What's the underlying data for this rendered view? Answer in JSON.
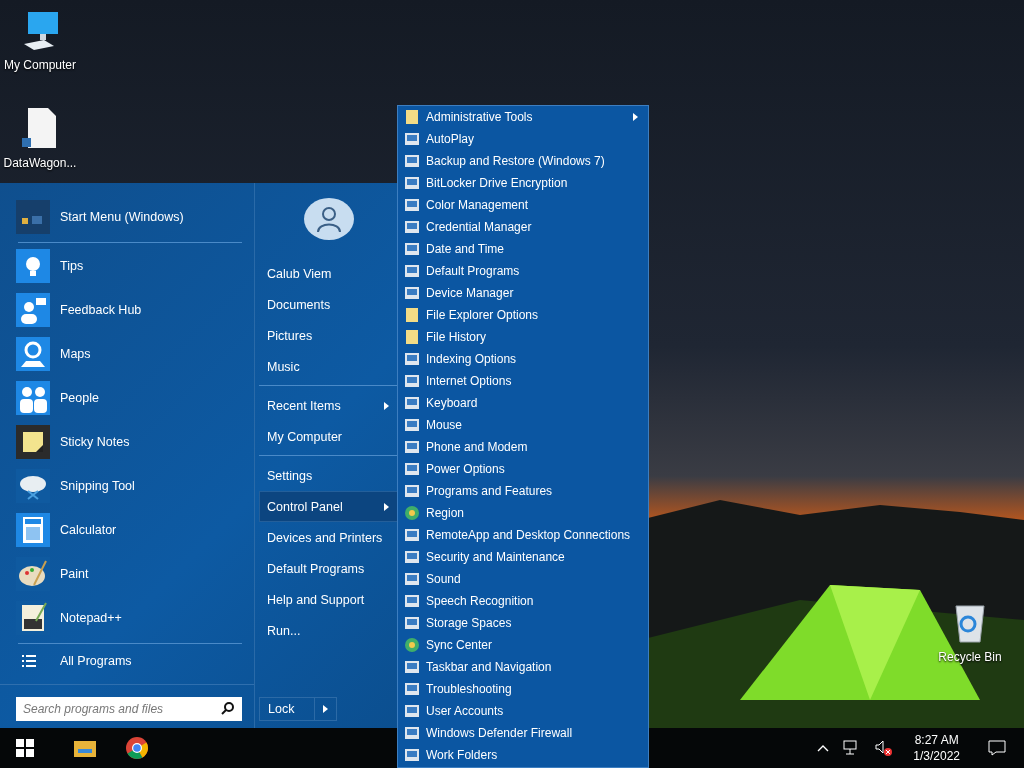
{
  "desktop_icons": [
    {
      "label": "My Computer",
      "kind": "computer"
    },
    {
      "label": "DataWagon...",
      "kind": "file"
    },
    {
      "label": "Recycle Bin",
      "kind": "recycle"
    }
  ],
  "start_menu": {
    "header": {
      "label": "Start Menu (Windows)",
      "kind": "start"
    },
    "pinned": [
      {
        "label": "Tips",
        "kind": "tips"
      },
      {
        "label": "Feedback Hub",
        "kind": "feedback"
      },
      {
        "label": "Maps",
        "kind": "maps"
      },
      {
        "label": "People",
        "kind": "people"
      },
      {
        "label": "Sticky Notes",
        "kind": "sticky"
      },
      {
        "label": "Snipping Tool",
        "kind": "snipping"
      },
      {
        "label": "Calculator",
        "kind": "calculator"
      },
      {
        "label": "Paint",
        "kind": "paint"
      },
      {
        "label": "Notepad++",
        "kind": "notepad"
      }
    ],
    "all_programs": "All Programs",
    "search": {
      "placeholder": "Search programs and files"
    },
    "place_groups": [
      {
        "items": [
          {
            "label": "Calub Viem",
            "submenu": false,
            "selected": false
          },
          {
            "label": "Documents",
            "submenu": false,
            "selected": false
          },
          {
            "label": "Pictures",
            "submenu": false,
            "selected": false
          },
          {
            "label": "Music",
            "submenu": false,
            "selected": false
          }
        ]
      },
      {
        "items": [
          {
            "label": "Recent Items",
            "submenu": true,
            "selected": false
          },
          {
            "label": "My Computer",
            "submenu": false,
            "selected": false
          }
        ]
      },
      {
        "items": [
          {
            "label": "Settings",
            "submenu": false,
            "selected": false
          },
          {
            "label": "Control Panel",
            "submenu": true,
            "selected": true
          },
          {
            "label": "Devices and Printers",
            "submenu": false,
            "selected": false
          },
          {
            "label": "Default Programs",
            "submenu": false,
            "selected": false
          },
          {
            "label": "Help and Support",
            "submenu": false,
            "selected": false
          },
          {
            "label": "Run...",
            "submenu": false,
            "selected": false
          }
        ]
      }
    ],
    "lock_button": {
      "label": "Lock"
    }
  },
  "control_panel_menu": [
    {
      "label": "Administrative Tools",
      "submenu": true,
      "kind": "folder"
    },
    {
      "label": "AutoPlay",
      "submenu": false,
      "kind": "applet"
    },
    {
      "label": "Backup and Restore (Windows 7)",
      "submenu": false,
      "kind": "applet"
    },
    {
      "label": "BitLocker Drive Encryption",
      "submenu": false,
      "kind": "applet"
    },
    {
      "label": "Color Management",
      "submenu": false,
      "kind": "applet"
    },
    {
      "label": "Credential Manager",
      "submenu": false,
      "kind": "applet"
    },
    {
      "label": "Date and Time",
      "submenu": false,
      "kind": "applet"
    },
    {
      "label": "Default Programs",
      "submenu": false,
      "kind": "applet"
    },
    {
      "label": "Device Manager",
      "submenu": false,
      "kind": "applet"
    },
    {
      "label": "File Explorer Options",
      "submenu": false,
      "kind": "folder"
    },
    {
      "label": "File History",
      "submenu": false,
      "kind": "folder"
    },
    {
      "label": "Indexing Options",
      "submenu": false,
      "kind": "applet"
    },
    {
      "label": "Internet Options",
      "submenu": false,
      "kind": "applet"
    },
    {
      "label": "Keyboard",
      "submenu": false,
      "kind": "applet"
    },
    {
      "label": "Mouse",
      "submenu": false,
      "kind": "applet"
    },
    {
      "label": "Phone and Modem",
      "submenu": false,
      "kind": "applet"
    },
    {
      "label": "Power Options",
      "submenu": false,
      "kind": "applet"
    },
    {
      "label": "Programs and Features",
      "submenu": false,
      "kind": "applet"
    },
    {
      "label": "Region",
      "submenu": false,
      "kind": "globe"
    },
    {
      "label": "RemoteApp and Desktop Connections",
      "submenu": false,
      "kind": "applet"
    },
    {
      "label": "Security and Maintenance",
      "submenu": false,
      "kind": "applet"
    },
    {
      "label": "Sound",
      "submenu": false,
      "kind": "applet"
    },
    {
      "label": "Speech Recognition",
      "submenu": false,
      "kind": "applet"
    },
    {
      "label": "Storage Spaces",
      "submenu": false,
      "kind": "applet"
    },
    {
      "label": "Sync Center",
      "submenu": false,
      "kind": "globe"
    },
    {
      "label": "Taskbar and Navigation",
      "submenu": false,
      "kind": "applet"
    },
    {
      "label": "Troubleshooting",
      "submenu": false,
      "kind": "applet"
    },
    {
      "label": "User Accounts",
      "submenu": false,
      "kind": "applet"
    },
    {
      "label": "Windows Defender Firewall",
      "submenu": false,
      "kind": "applet"
    },
    {
      "label": "Work Folders",
      "submenu": false,
      "kind": "applet"
    }
  ],
  "taskbar": {
    "clock": {
      "time": "8:27 AM",
      "date": "1/3/2022"
    }
  }
}
